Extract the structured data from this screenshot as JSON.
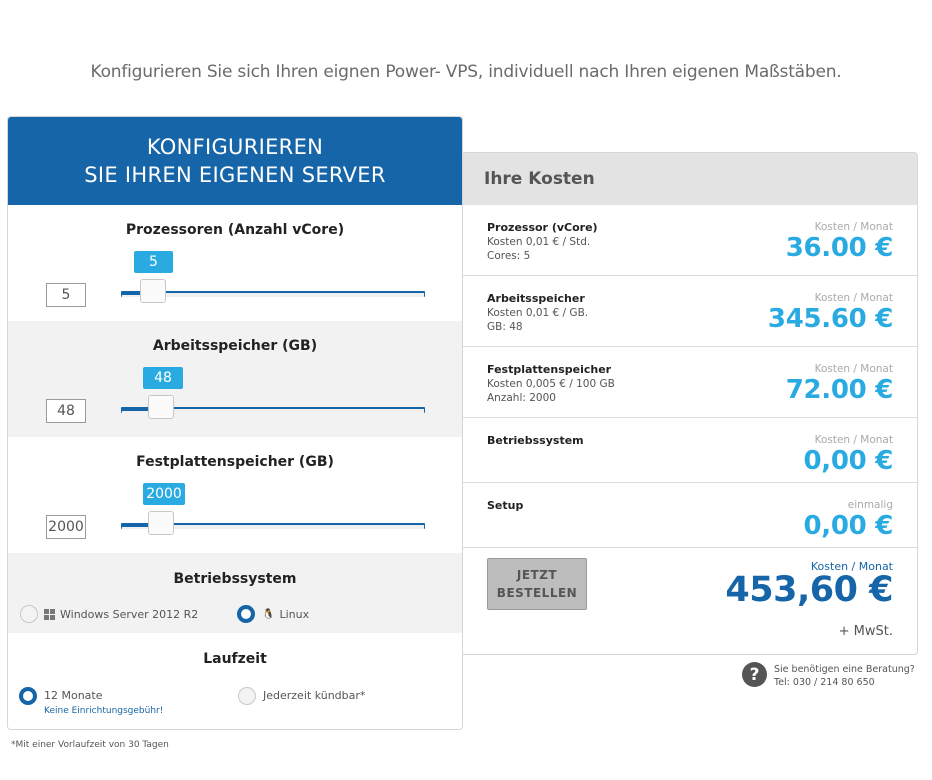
{
  "intro": "Konfigurieren Sie sich Ihren eignen Power- VPS, individuell nach Ihren eigenen Maßstäben.",
  "config": {
    "header_line1": "KONFIGURIEREN",
    "header_line2": "SIE IHREN EIGENEN SERVER",
    "cpu": {
      "title": "Prozessoren (Anzahl vCore)",
      "value": "5",
      "bubble": "5",
      "fraction": 0.06
    },
    "ram": {
      "title": "Arbeitsspeicher (GB)",
      "value": "48",
      "bubble": "48",
      "fraction": 0.09
    },
    "disk": {
      "title": "Festplattenspeicher (GB)",
      "value": "2000",
      "bubble": "2000",
      "fraction": 0.09
    },
    "os": {
      "title": "Betriebssystem",
      "option1": "Windows Server 2012 R2",
      "option2": "Linux",
      "selected": "Linux"
    },
    "term": {
      "title": "Laufzeit",
      "option1": "12 Monate",
      "option1_note": "Keine Einrichtungsgebühr!",
      "option2": "Jederzeit kündbar*",
      "selected": "12 Monate"
    },
    "footnote": "*Mit einer Vorlaufzeit von 30 Tagen"
  },
  "costs": {
    "title": "Ihre Kosten",
    "rows": [
      {
        "title": "Prozessor (vCore)",
        "detail1": "Kosten 0,01 € / Std.",
        "detail2": "Cores: 5",
        "period": "Kosten / Monat",
        "amount": "36.00 €"
      },
      {
        "title": "Arbeitsspeicher",
        "detail1": "Kosten 0,01 € / GB.",
        "detail2": "GB: 48",
        "period": "Kosten / Monat",
        "amount": "345.60 €"
      },
      {
        "title": "Festplattenspeicher",
        "detail1": "Kosten 0,005 € / 100 GB",
        "detail2": "Anzahl: 2000",
        "period": "Kosten / Monat",
        "amount": "72.00 €"
      },
      {
        "title": "Betriebssystem",
        "period": "Kosten / Monat",
        "amount": "0,00 €"
      },
      {
        "title": "Setup",
        "period": "einmalig",
        "amount": "0,00 €"
      }
    ],
    "order_line1": "JETZT",
    "order_line2": "BESTELLEN",
    "total_period": "Kosten / Monat",
    "total_amount": "453,60 €",
    "tax": "+ MwSt."
  },
  "help": {
    "icon": "?",
    "line1": "Sie benötigen eine Beratung?",
    "line2": "Tel: 030 / 214 80 650"
  },
  "colors": {
    "primary": "#1565a8",
    "accent": "#29abe2"
  }
}
